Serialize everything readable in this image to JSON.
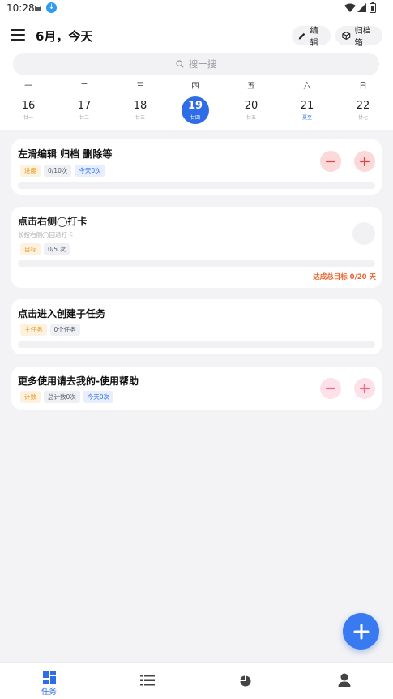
{
  "status_bar": {
    "time": "10:28"
  },
  "header": {
    "title": "6月，今天",
    "edit_label": "编辑",
    "archive_label": "归档箱"
  },
  "search": {
    "placeholder": "搜一搜"
  },
  "calendar": {
    "days": [
      {
        "weekday": "一",
        "date": "16",
        "lunar": "廿一"
      },
      {
        "weekday": "二",
        "date": "17",
        "lunar": "廿二"
      },
      {
        "weekday": "三",
        "date": "18",
        "lunar": "廿三"
      },
      {
        "weekday": "四",
        "date": "19",
        "lunar": "廿四",
        "selected": true
      },
      {
        "weekday": "五",
        "date": "20",
        "lunar": "廿五"
      },
      {
        "weekday": "六",
        "date": "21",
        "lunar": "夏至"
      },
      {
        "weekday": "日",
        "date": "22",
        "lunar": "廿七"
      }
    ]
  },
  "tasks": [
    {
      "title": "左滑编辑 归档 删除等",
      "tags": [
        "进度",
        "0/10次",
        "今天0次"
      ]
    },
    {
      "title": "点击右侧◯打卡",
      "subtitle": "长按右侧◯回退打卡",
      "tags": [
        "目标",
        "0/5 次"
      ],
      "goal": "达成总目标 0/20 天"
    },
    {
      "title": "点击进入创建子任务",
      "tags": [
        "主任务",
        "0个任务"
      ]
    },
    {
      "title": "更多使用请去我的-使用帮助",
      "tags": [
        "计数",
        "总计数0次",
        "今天0次"
      ]
    }
  ],
  "bottom_nav": {
    "tasks_label": "任务"
  },
  "colors": {
    "accent": "#2f6de6",
    "minus_red": "#e64545",
    "plus_pink": "#f06a8a"
  }
}
